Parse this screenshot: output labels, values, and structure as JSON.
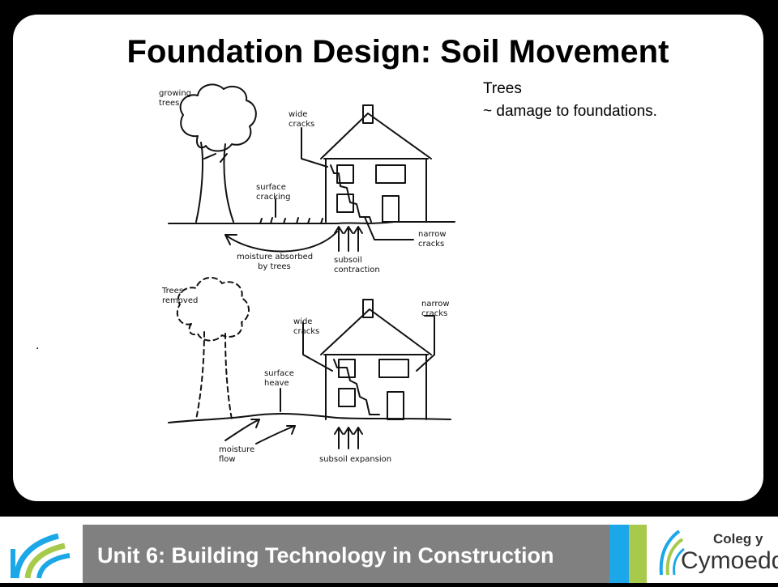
{
  "slide": {
    "title": "Foundation Design: Soil Movement",
    "note_line1": "Trees",
    "note_line2": "~ damage to foundations.",
    "stray_mark": "."
  },
  "diagram": {
    "top": {
      "growing_trees_1": "growing",
      "growing_trees_2": "trees",
      "wide_cracks_1": "wide",
      "wide_cracks_2": "cracks",
      "surface_cracking_1": "surface",
      "surface_cracking_2": "cracking",
      "narrow_cracks_1": "narrow",
      "narrow_cracks_2": "cracks",
      "moisture_1": "moisture absorbed",
      "moisture_2": "by trees",
      "subsoil_1": "subsoil",
      "subsoil_2": "contraction"
    },
    "bottom": {
      "trees_removed_1": "Trees",
      "trees_removed_2": "removed",
      "wide_cracks_1": "wide",
      "wide_cracks_2": "cracks",
      "narrow_cracks_1": "narrow",
      "narrow_cracks_2": "cracks",
      "surface_heave_1": "surface",
      "surface_heave_2": "heave",
      "moisture_flow_1": "moisture",
      "moisture_flow_2": "flow",
      "subsoil_expansion": "subsoil expansion"
    }
  },
  "footer": {
    "unit_title": "Unit 6: Building Technology in Construction",
    "logo_line1": "Coleg y",
    "logo_line2": "Cymoedd",
    "colors": {
      "bar": "#808080",
      "blue": "#1ba7e8",
      "green": "#a7c94c"
    }
  }
}
